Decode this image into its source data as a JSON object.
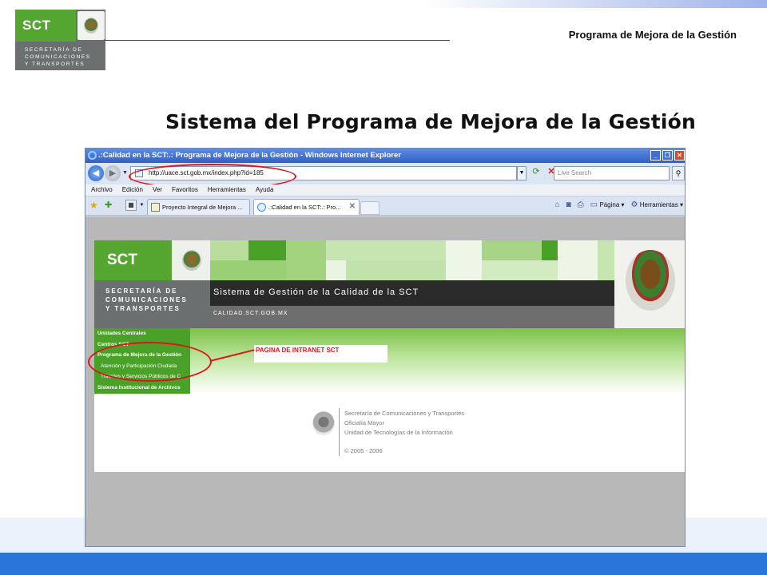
{
  "slide": {
    "program_title": "Programa de Mejora de la Gestión",
    "main_title": "Sistema del Programa de Mejora de la Gestión",
    "logo": {
      "abbr": "SCT",
      "lines": [
        "SECRETARÍA DE",
        "COMUNICACIONES",
        "Y TRANSPORTES"
      ]
    }
  },
  "browser": {
    "window_title": ".:Calidad en la SCT:.: Programa de Mejora de la Gestión - Windows Internet Explorer",
    "address_url": "http://uace.sct.gob.mx/index.php?id=185",
    "search_placeholder": "Live Search",
    "menu": [
      "Archivo",
      "Edición",
      "Ver",
      "Favoritos",
      "Herramientas",
      "Ayuda"
    ],
    "tabs": [
      {
        "label": "Proyecto Integral de Mejora ..."
      },
      {
        "label": ".:Calidad en la SCT:.: Pro..."
      }
    ],
    "commands": {
      "page": "Página",
      "tools": "Herramientas"
    }
  },
  "webpage": {
    "logo_abbr": "SCT",
    "logo_lines": [
      "SECRETARÍA DE",
      "COMUNICACIONES",
      "Y TRANSPORTES"
    ],
    "system_title": "Sistema de Gestión de la Calidad de la SCT",
    "site": "CALIDAD.SCT.GOB.MX",
    "left_menu": [
      "Unidades Centrales",
      "Centros SCT",
      "Programa de Mejora de la Gestión",
      "Atención y Participación Ciudada",
      "Trámites y Servicios Públicos de C",
      "Sistema Institucional de Archivos"
    ],
    "intranet_link": "PAGINA DE INTRANET SCT",
    "footer": {
      "lines": [
        "Secretaría de Comunicaciones y Transportes",
        "Oficialía Mayor",
        "Unidad de Tecnologías de la Información"
      ],
      "copyright": "© 2005 - 2006"
    }
  }
}
